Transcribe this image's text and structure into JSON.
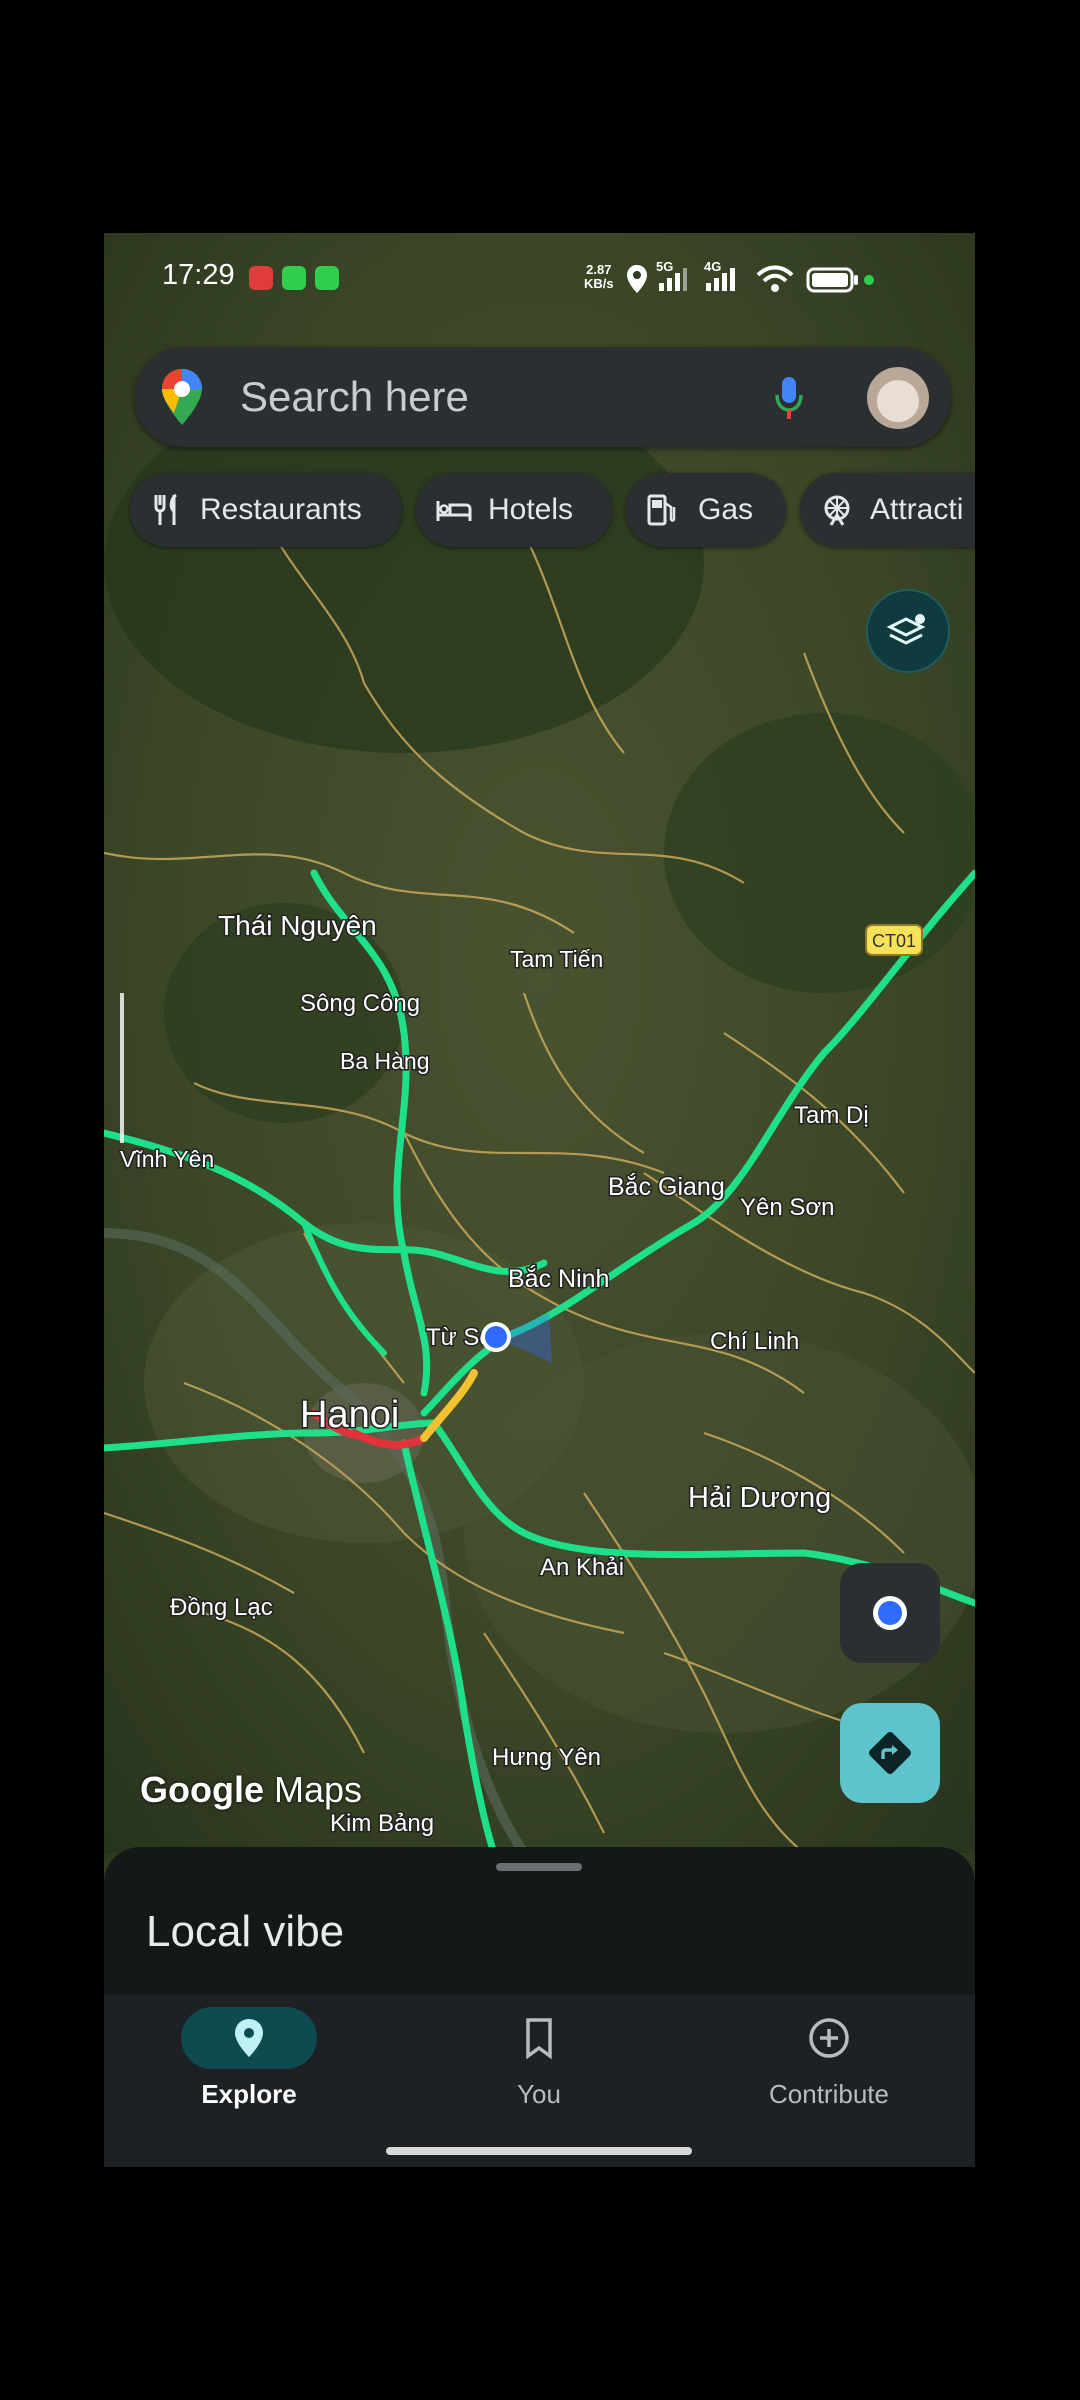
{
  "status_bar": {
    "time": "17:29",
    "net_speed_value": "2.87",
    "net_speed_unit": "KB/s",
    "network_1": "5G",
    "network_2": "4G"
  },
  "search": {
    "placeholder": "Search here",
    "logo_icon": "google-maps-pin-icon",
    "mic_icon": "mic-icon"
  },
  "chips": [
    {
      "label": "Restaurants",
      "icon": "fork-knife-icon"
    },
    {
      "label": "Hotels",
      "icon": "bed-icon"
    },
    {
      "label": "Gas",
      "icon": "gas-pump-icon"
    },
    {
      "label": "Attracti",
      "icon": "ferris-wheel-icon"
    }
  ],
  "map": {
    "labels": {
      "thai_nguyen": "Thái Nguyên",
      "tam_tien": "Tam Tiến",
      "song_cong": "Sông Công",
      "ba_hang": "Ba Hàng",
      "vinh_yen": "Vĩnh Yên",
      "bac_giang": "Bắc Giang",
      "yen_son": "Yên Sơn",
      "tam_di": "Tam Dị",
      "bac_ninh": "Bắc Ninh",
      "tu_son": "Từ Sơ",
      "chi_linh": "Chí Linh",
      "hanoi": "Hanoi",
      "hai_duong": "Hải Dương",
      "an_khai": "An Khải",
      "dong_lac": "Đồng Lạc",
      "hung_yen": "Hưng Yên",
      "kim_bang": "Kim Bảng"
    },
    "road_shield": "CT01",
    "watermark_brand": "Google",
    "watermark_product": "Maps",
    "colors": {
      "traffic_green": "#1fe08a",
      "traffic_red": "#e0343a",
      "traffic_yellow": "#f2c230",
      "location_blue": "#2f6bff"
    }
  },
  "sheet": {
    "title": "Local vibe"
  },
  "nav": [
    {
      "label": "Explore",
      "icon": "explore-pin-icon",
      "active": true
    },
    {
      "label": "You",
      "icon": "bookmark-icon",
      "active": false
    },
    {
      "label": "Contribute",
      "icon": "add-circle-icon",
      "active": false
    }
  ]
}
